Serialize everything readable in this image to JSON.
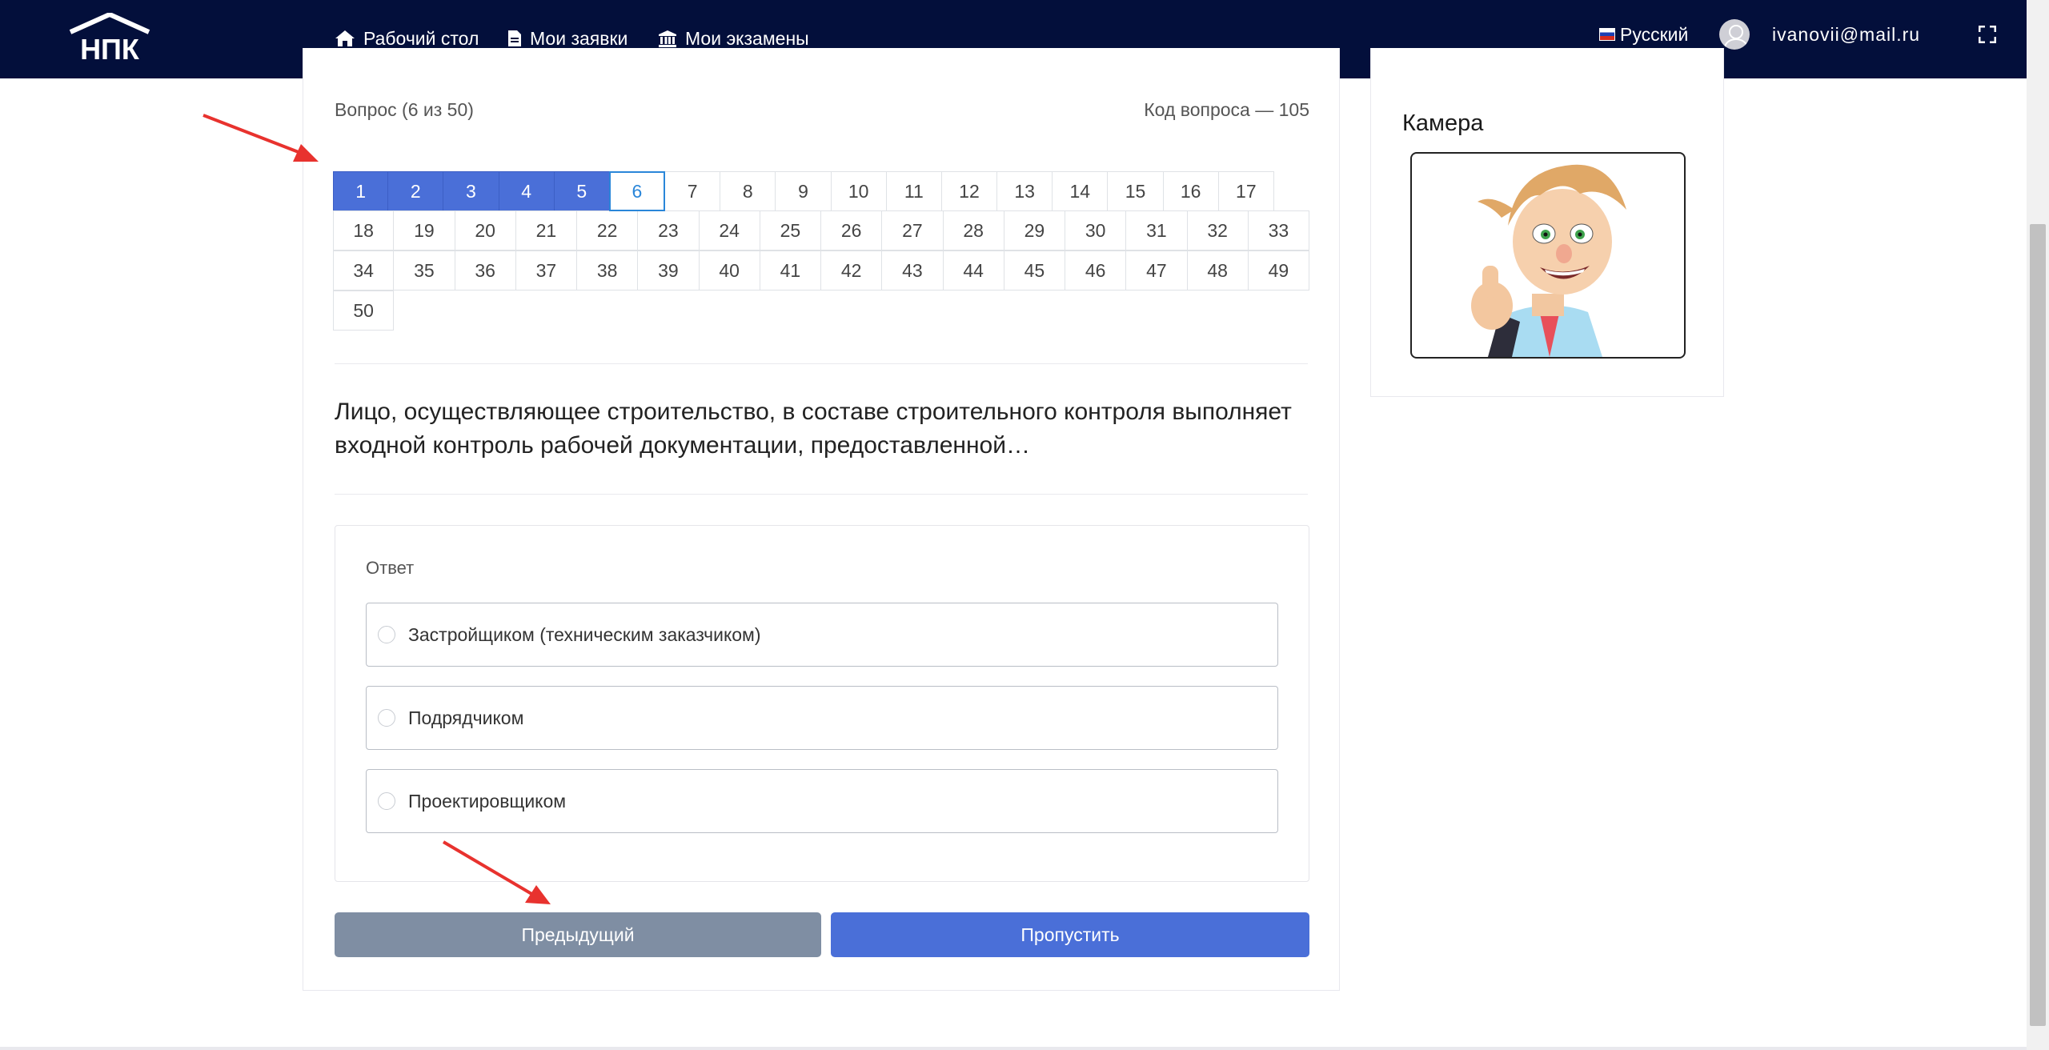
{
  "header": {
    "logo_text": "НПК",
    "nav": [
      {
        "label": "Рабочий стол",
        "icon": "home-icon"
      },
      {
        "label": "Мои заявки",
        "icon": "document-icon"
      },
      {
        "label": "Мои экзамены",
        "icon": "institution-icon"
      }
    ],
    "language": "Русский",
    "user_email": "ivanovii@mail.ru"
  },
  "exam": {
    "question_counter": "Вопрос (6 из 50)",
    "question_code": "Код вопроса — 105",
    "current_question": 6,
    "answered_questions": [
      1,
      2,
      3,
      4,
      5
    ],
    "question_grid": [
      [
        "1",
        "2",
        "3",
        "4",
        "5",
        "6",
        "7",
        "8",
        "9",
        "10",
        "11",
        "12",
        "13",
        "14",
        "15",
        "16",
        "17"
      ],
      [
        "18",
        "19",
        "20",
        "21",
        "22",
        "23",
        "24",
        "25",
        "26",
        "27",
        "28",
        "29",
        "30",
        "31",
        "32",
        "33"
      ],
      [
        "34",
        "35",
        "36",
        "37",
        "38",
        "39",
        "40",
        "41",
        "42",
        "43",
        "44",
        "45",
        "46",
        "47",
        "48",
        "49"
      ],
      [
        "50"
      ]
    ],
    "question_text": "Лицо, осуществляющее строительство, в составе строительного контроля выполняет входной контроль рабочей документации, предоставленной…",
    "answer_title": "Ответ",
    "options": [
      "Застройщиком (техническим заказчиком)",
      "Подрядчиком",
      "Проектировщиком"
    ],
    "buttons": {
      "previous": "Предыдущий",
      "skip": "Пропустить"
    }
  },
  "camera": {
    "title": "Камера"
  },
  "colors": {
    "header_bg": "#030f3b",
    "answered": "#4a6fd8",
    "current_border": "#2a86d9",
    "prev_button": "#7f8ea3",
    "skip_button": "#4a6fd8",
    "annotation_arrow": "#e8322e"
  }
}
